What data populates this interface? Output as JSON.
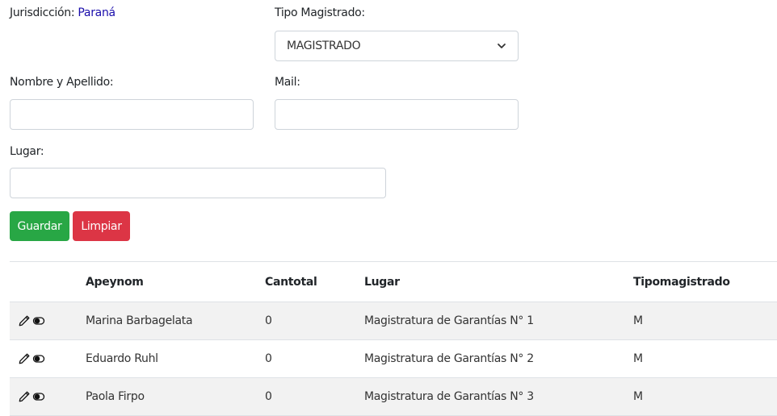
{
  "form": {
    "jurisdiccion_label": "Jurisdicción:",
    "jurisdiccion_value": "Paraná",
    "tipo_label": "Tipo Magistrado:",
    "tipo_value": "MAGISTRADO",
    "nombre_label": "Nombre y Apellido:",
    "nombre_value": "",
    "mail_label": "Mail:",
    "mail_value": "",
    "lugar_label": "Lugar:",
    "lugar_value": "",
    "save_label": "Guardar",
    "clear_label": "Limpiar"
  },
  "table": {
    "headers": [
      "",
      "Apeynom",
      "Cantotal",
      "Lugar",
      "Tipomagistrado"
    ],
    "rows": [
      {
        "apeynom": "Marina Barbagelata",
        "cantotal": "0",
        "lugar": "Magistratura de Garantías N° 1",
        "tipo": "M"
      },
      {
        "apeynom": "Eduardo Ruhl",
        "cantotal": "0",
        "lugar": "Magistratura de Garantías N° 2",
        "tipo": "M"
      },
      {
        "apeynom": "Paola Firpo",
        "cantotal": "0",
        "lugar": "Magistratura de Garantías N° 3",
        "tipo": "M"
      }
    ]
  },
  "icons": {
    "edit": "pencil-icon",
    "toggle": "toggle-icon"
  },
  "colors": {
    "save": "#28a745",
    "clear": "#dc3545",
    "link": "#1a0dab",
    "row_stripe": "#f2f2f2"
  }
}
